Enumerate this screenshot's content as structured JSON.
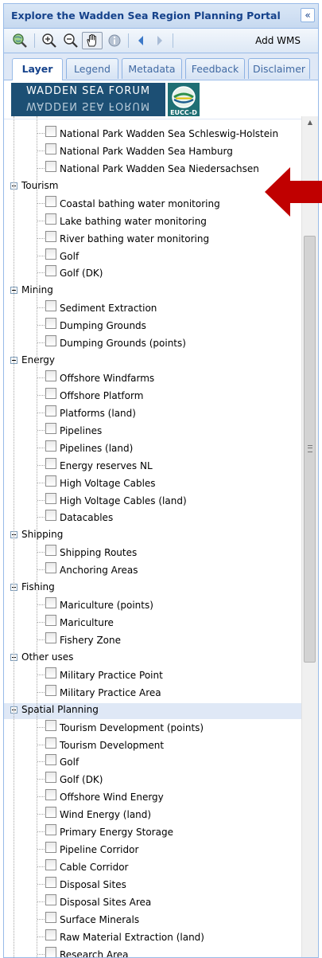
{
  "panel": {
    "title": "Explore the Wadden Sea Region Planning Portal"
  },
  "toolbar": {
    "buttons": [
      {
        "name": "zoom-full-extent",
        "icon": "globe-magnifier-icon"
      },
      {
        "name": "zoom-in",
        "icon": "zoom-in-icon"
      },
      {
        "name": "zoom-out",
        "icon": "zoom-out-icon"
      },
      {
        "name": "pan",
        "icon": "hand-pan-icon",
        "active": true
      },
      {
        "name": "info",
        "icon": "info-icon"
      },
      {
        "name": "back",
        "icon": "arrow-left-icon"
      },
      {
        "name": "forward",
        "icon": "arrow-right-icon"
      }
    ],
    "add_wms_label": "Add WMS"
  },
  "tabs": [
    {
      "label": "Layer",
      "active": true
    },
    {
      "label": "Legend"
    },
    {
      "label": "Metadata"
    },
    {
      "label": "Feedback"
    },
    {
      "label": "Disclaimer"
    }
  ],
  "logo": {
    "text": "WADDEN SEA FORUM",
    "badge": "EUCC-D"
  },
  "colors": {
    "accent": "#15428b",
    "highlight_row": "#dfe8f6",
    "annotation_arrow": "#c00000"
  },
  "tree": [
    {
      "type": "layer",
      "label": "National Park Wadden Sea Schleswig-Holstein"
    },
    {
      "type": "layer",
      "label": "National Park Wadden Sea Hamburg"
    },
    {
      "type": "layer",
      "label": "National Park Wadden Sea Niedersachsen"
    },
    {
      "type": "group",
      "label": "Tourism"
    },
    {
      "type": "layer",
      "label": "Coastal bathing water monitoring"
    },
    {
      "type": "layer",
      "label": "Lake bathing water monitoring"
    },
    {
      "type": "layer",
      "label": "River bathing water monitoring"
    },
    {
      "type": "layer",
      "label": "Golf"
    },
    {
      "type": "layer",
      "label": "Golf (DK)"
    },
    {
      "type": "group",
      "label": "Mining"
    },
    {
      "type": "layer",
      "label": "Sediment Extraction"
    },
    {
      "type": "layer",
      "label": "Dumping Grounds"
    },
    {
      "type": "layer",
      "label": "Dumping Grounds (points)"
    },
    {
      "type": "group",
      "label": "Energy"
    },
    {
      "type": "layer",
      "label": "Offshore Windfarms"
    },
    {
      "type": "layer",
      "label": "Offshore Platform"
    },
    {
      "type": "layer",
      "label": "Platforms (land)"
    },
    {
      "type": "layer",
      "label": "Pipelines"
    },
    {
      "type": "layer",
      "label": "Pipelines (land)"
    },
    {
      "type": "layer",
      "label": "Energy reserves NL"
    },
    {
      "type": "layer",
      "label": "High Voltage Cables"
    },
    {
      "type": "layer",
      "label": "High Voltage Cables (land)"
    },
    {
      "type": "layer",
      "label": "Datacables"
    },
    {
      "type": "group",
      "label": "Shipping"
    },
    {
      "type": "layer",
      "label": "Shipping Routes"
    },
    {
      "type": "layer",
      "label": "Anchoring Areas"
    },
    {
      "type": "group",
      "label": "Fishing"
    },
    {
      "type": "layer",
      "label": "Mariculture (points)"
    },
    {
      "type": "layer",
      "label": "Mariculture"
    },
    {
      "type": "layer",
      "label": "Fishery Zone"
    },
    {
      "type": "group",
      "label": "Other uses"
    },
    {
      "type": "layer",
      "label": "Military Practice Point"
    },
    {
      "type": "layer",
      "label": "Military Practice Area"
    },
    {
      "type": "group",
      "label": "Spatial Planning",
      "highlighted": true
    },
    {
      "type": "layer",
      "label": "Tourism Development (points)"
    },
    {
      "type": "layer",
      "label": "Tourism Development"
    },
    {
      "type": "layer",
      "label": "Golf"
    },
    {
      "type": "layer",
      "label": "Golf (DK)"
    },
    {
      "type": "layer",
      "label": "Offshore Wind Energy"
    },
    {
      "type": "layer",
      "label": "Wind Energy (land)"
    },
    {
      "type": "layer",
      "label": "Primary Energy Storage"
    },
    {
      "type": "layer",
      "label": "Pipeline Corridor"
    },
    {
      "type": "layer",
      "label": "Cable Corridor"
    },
    {
      "type": "layer",
      "label": "Disposal Sites"
    },
    {
      "type": "layer",
      "label": "Disposal Sites Area"
    },
    {
      "type": "layer",
      "label": "Surface Minerals"
    },
    {
      "type": "layer",
      "label": "Raw Material Extraction (land)"
    },
    {
      "type": "layer",
      "label": "Research Area"
    }
  ]
}
